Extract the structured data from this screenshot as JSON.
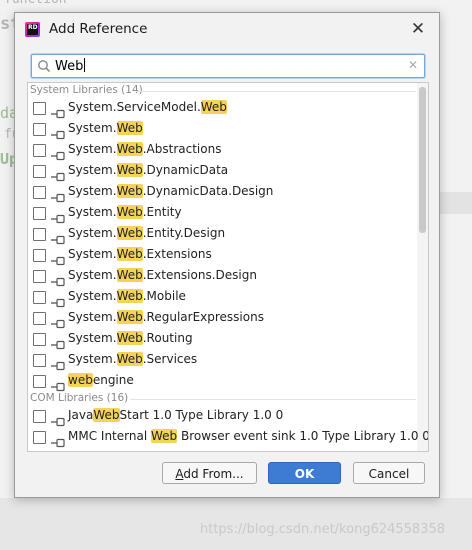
{
  "background": {
    "snippet_1": "function",
    "snippet_2": "st",
    "snippet_3": "da",
    "snippet_4": "fu",
    "snippet_5": "Up",
    "watermark": "https://blog.csdn.net/kong624558358"
  },
  "dialog": {
    "title": "Add Reference",
    "app_icon_text": "RD",
    "close_glyph": "✕",
    "search": {
      "value": "Web",
      "clear_glyph": "✕"
    }
  },
  "groups": [
    {
      "name": "System Libraries (14)",
      "items": [
        {
          "pre": "System.ServiceModel.",
          "match": "Web",
          "post": ""
        },
        {
          "pre": "System.",
          "match": "Web",
          "post": ""
        },
        {
          "pre": "System.",
          "match": "Web",
          "post": ".Abstractions"
        },
        {
          "pre": "System.",
          "match": "Web",
          "post": ".DynamicData"
        },
        {
          "pre": "System.",
          "match": "Web",
          "post": ".DynamicData.Design"
        },
        {
          "pre": "System.",
          "match": "Web",
          "post": ".Entity"
        },
        {
          "pre": "System.",
          "match": "Web",
          "post": ".Entity.Design"
        },
        {
          "pre": "System.",
          "match": "Web",
          "post": ".Extensions"
        },
        {
          "pre": "System.",
          "match": "Web",
          "post": ".Extensions.Design"
        },
        {
          "pre": "System.",
          "match": "Web",
          "post": ".Mobile"
        },
        {
          "pre": "System.",
          "match": "Web",
          "post": ".RegularExpressions"
        },
        {
          "pre": "System.",
          "match": "Web",
          "post": ".Routing"
        },
        {
          "pre": "System.",
          "match": "Web",
          "post": ".Services"
        },
        {
          "pre": "",
          "match": "web",
          "post": "engine"
        }
      ]
    },
    {
      "name": "COM Libraries (16)",
      "items": [
        {
          "pre": "Java",
          "match": "Web",
          "post": "Start 1.0 Type Library 1.0 0"
        },
        {
          "pre": "MMC Internal ",
          "match": "Web",
          "post": " Browser event sink 1.0 Type Library 1.0 0"
        }
      ]
    }
  ],
  "buttons": {
    "add_from": {
      "mnemonic": "A",
      "rest": "dd From..."
    },
    "ok": "OK",
    "cancel": "Cancel"
  },
  "colors": {
    "highlight": "#f5d358",
    "primary": "#3e7cd4",
    "focus_border": "#7aa7de"
  }
}
